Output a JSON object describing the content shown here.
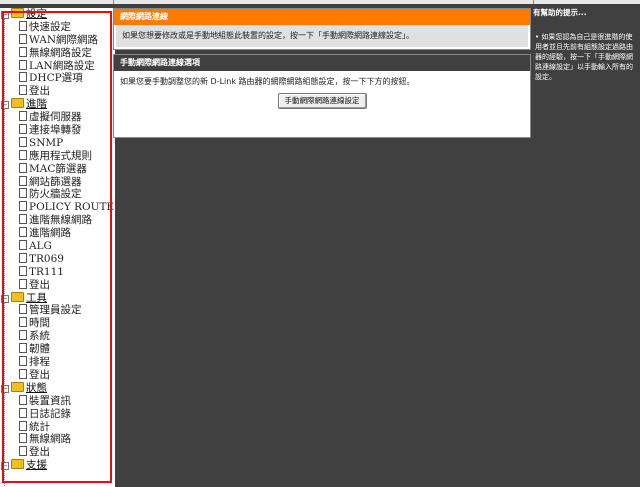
{
  "tree": {
    "groups": [
      {
        "label": "設定",
        "items": [
          "快速設定",
          "WAN網際網路",
          "無線網路設定",
          "LAN網路設定",
          "DHCP選項",
          "登出"
        ]
      },
      {
        "label": "進階",
        "items": [
          "虛擬伺服器",
          "連接埠轉發",
          "SNMP",
          "應用程式規則",
          "MAC篩選器",
          "網站篩選器",
          "防火牆設定",
          "POLICY ROUTE",
          "進階無線網路",
          "進階網路",
          "ALG",
          "TR069",
          "TR111",
          "登出"
        ]
      },
      {
        "label": "工具",
        "items": [
          "管理員設定",
          "時間",
          "系統",
          "韌體",
          "排程",
          "登出"
        ]
      },
      {
        "label": "狀態",
        "items": [
          "裝置資訊",
          "日誌記錄",
          "統計",
          "無線網路",
          "登出"
        ]
      },
      {
        "label": "支援",
        "items": []
      }
    ]
  },
  "panel1": {
    "title": "網際網路連線",
    "text": "如果您想要修改或是手動地組態此裝置的設定，按一下「手動網際網路連線設定」。"
  },
  "panel2": {
    "title": "手動網際網路連線選項",
    "text": "如果您要手動調整您的新 D-Link 路由器的網際網路組態設定，按一下下方的按鈕。",
    "button": "手動網際網路連線設定"
  },
  "hint": {
    "title": "有幫助的提示...",
    "text": "• 如果您認為自己是很進階的使用者並且先前有組態設定過路由器的經驗，按一下「手動網際網路連線設定」以手動輸入所有的設定。"
  },
  "colors": {
    "accent": "#ff7a00",
    "highlight": "#e01010",
    "background": "#404040"
  }
}
